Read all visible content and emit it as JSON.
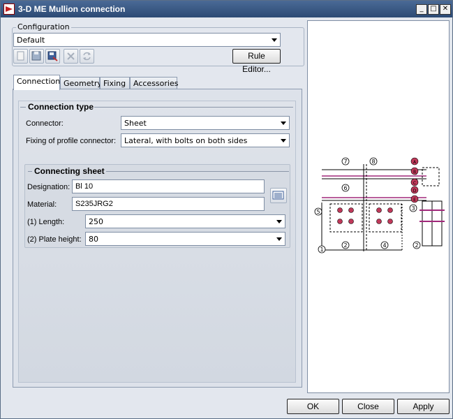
{
  "window": {
    "title": "3-D ME Mullion connection"
  },
  "config": {
    "group_label": "Configuration",
    "selected": "Default",
    "rule_editor_label": "Rule Editor..."
  },
  "tabs": [
    {
      "label": "Connection"
    },
    {
      "label": "Geometry"
    },
    {
      "label": "Fixing"
    },
    {
      "label": "Accessories"
    }
  ],
  "connection_type": {
    "header": "Connection type",
    "connector_label": "Connector:",
    "connector_value": "Sheet",
    "fixing_label": "Fixing of profile connector:",
    "fixing_value": "Lateral, with bolts on both sides"
  },
  "connecting_sheet": {
    "header": "Connecting sheet",
    "designation_label": "Designation:",
    "designation_value": "Bl 10",
    "material_label": "Material:",
    "material_value": "S235JRG2",
    "length_label": "(1)  Length:",
    "length_value": "250",
    "plate_height_label": "(2)  Plate height:",
    "plate_height_value": "80"
  },
  "diagram_labels": [
    "7",
    "8",
    "6",
    "5",
    "3",
    "1",
    "2",
    "4",
    "4",
    "2",
    "A",
    "B",
    "C",
    "D",
    "E"
  ],
  "buttons": {
    "ok": "OK",
    "close": "Close",
    "apply": "Apply"
  },
  "colors": {
    "titlebar": "#2c4a74",
    "bolt": "#c0395a",
    "bar": "#a0287a"
  }
}
